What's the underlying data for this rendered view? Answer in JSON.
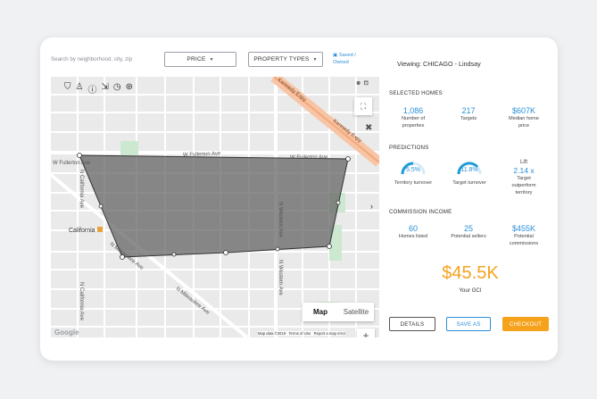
{
  "toolbar": {
    "search_placeholder": "Search by neighborhood, city, zip",
    "price_label": "PRICE",
    "property_types_label": "PROPERTY TYPES",
    "saved_line1": "Saved /",
    "saved_line2": "Owned"
  },
  "header": {
    "viewing": "Viewing: CHICAGO - Lindsay"
  },
  "map": {
    "streets": {
      "fullerton": "W Fullerton Ave",
      "fullerton_left": "W Fullerton Ave",
      "milwaukee": "N Milwaukee Ave",
      "milwaukee2": "N Milwaukee Ave",
      "kennedy": "Kennedy Expy",
      "kennedy2": "Kennedy Expy",
      "western": "N Western Ave",
      "western2": "N Western Ave",
      "california": "N California Ave",
      "california2": "N California Ave"
    },
    "place_label": "California",
    "toggle_map": "Map",
    "toggle_satellite": "Satellite",
    "zoom_in": "+",
    "zoom_out": "−",
    "attribution": "Map data ©2019   Terms of Use   Report a map error",
    "google": "Google"
  },
  "selected_homes": {
    "title": "SELECTED HOMES",
    "stats": [
      {
        "value": "1,086",
        "label_line1": "Number of",
        "label_line2": "properties"
      },
      {
        "value": "217",
        "label_line1": "Targets",
        "label_line2": ""
      },
      {
        "value": "$607K",
        "label_line1": "Median home",
        "label_line2": "price"
      }
    ]
  },
  "predictions": {
    "title": "PREDICTIONS",
    "territory_value": "5.5%",
    "territory_label": "Territory turnover",
    "target_value": "11.8%",
    "target_label": "Target turnover",
    "lift_label": "Lift",
    "lift_value": "2.14 x",
    "lift_desc_1": "Target",
    "lift_desc_2": "outperform",
    "lift_desc_3": "territory",
    "territory_fraction": 0.055,
    "target_fraction": 0.118
  },
  "commission": {
    "title": "COMMISSION INCOME",
    "stats": [
      {
        "value": "60",
        "label_line1": "Homes listed",
        "label_line2": ""
      },
      {
        "value": "25",
        "label_line1": "Potential sellers",
        "label_line2": ""
      },
      {
        "value": "$455K",
        "label_line1": "Potential",
        "label_line2": "commissions"
      }
    ]
  },
  "gci": {
    "value": "$45.5K",
    "label": "Your GCI"
  },
  "buttons": {
    "details": "DETAILS",
    "save_as": "SAVE AS",
    "checkout": "CHECKOUT"
  },
  "colors": {
    "accent_blue": "#2a8fd8",
    "orange": "#f5a21d",
    "polygon_fill": "#5f5f5f"
  }
}
